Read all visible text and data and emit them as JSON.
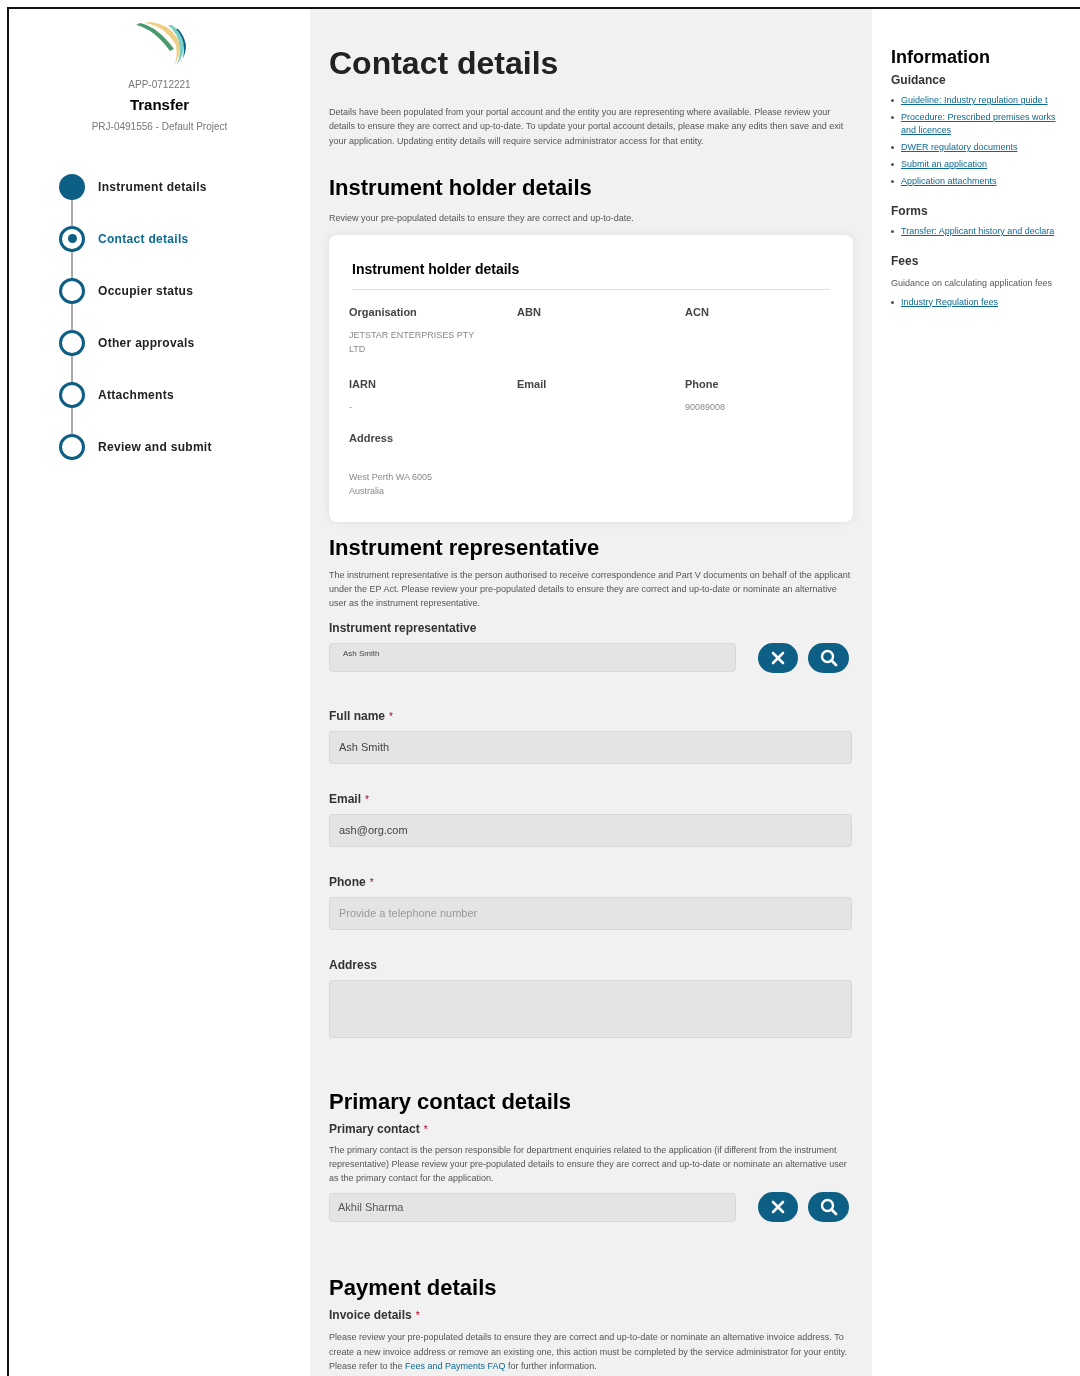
{
  "sidebar": {
    "application_id": "APP-0712221",
    "title": "Transfer",
    "project": "PRJ-0491556 - Default Project",
    "steps": [
      {
        "label": "Instrument details",
        "kind": "complete",
        "selected": false
      },
      {
        "label": "Contact details",
        "kind": "current",
        "selected": true
      },
      {
        "label": "Occupier status",
        "kind": "pending",
        "selected": false
      },
      {
        "label": "Other approvals",
        "kind": "pending",
        "selected": false
      },
      {
        "label": "Attachments",
        "kind": "pending",
        "selected": false
      },
      {
        "label": "Review and submit",
        "kind": "pending",
        "selected": false
      }
    ]
  },
  "main": {
    "title": "Contact details",
    "intro": "Details have been populated from your portal account and the entity you are representing where available. Please review your details to ensure they are correct and up-to-date. To update your portal account details, please make any edits then save and exit your application. Updating entity details will require service administrator access for that entity.",
    "holder": {
      "heading": "Instrument holder details",
      "description": "Review your pre-populated details to ensure they are correct and up-to-date.",
      "card_title": "Instrument holder details",
      "fields": [
        {
          "label": "Organisation",
          "value": "JETSTAR ENTERPRISES PTY LTD"
        },
        {
          "label": "ABN"
        },
        {
          "label": "ACN"
        },
        {
          "label": "IARN",
          "value": "-"
        },
        {
          "label": "Email"
        },
        {
          "label": "Phone",
          "value": "90089008"
        },
        {
          "label": "Address",
          "value": "West Perth WA 6005\nAustralia"
        }
      ]
    },
    "representative": {
      "heading": "Instrument representative",
      "description": "The instrument representative is the person authorised to receive correspondence and Part V documents on behalf of the applicant under the EP Act. Please review your pre-populated details to ensure they are correct and up-to-date or nominate an alternative user as the instrument representative.",
      "lookup_label": "Instrument representative",
      "lookup_value": "Ash Smith",
      "fields": [
        {
          "kind": "input",
          "label": "Full name",
          "required_marker": "*",
          "value": "Ash Smith"
        },
        {
          "kind": "input",
          "label": "Email",
          "required_marker": "*",
          "value": "ash@org.com"
        },
        {
          "kind": "input",
          "label": "Phone",
          "required_marker": "*",
          "placeholder": "Provide a telephone number"
        },
        {
          "kind": "textarea",
          "label": "Address"
        }
      ]
    },
    "primary_contact": {
      "heading": "Primary contact details",
      "label": "Primary contact",
      "required_marker": "*",
      "description": "The primary contact is the person responsible for department enquiries related to the application (if different from the instrument representative) Please review your pre-populated details to ensure they are correct and up-to-date or nominate an alternative user as the primary contact for the application.",
      "value": "Akhil Sharma"
    },
    "payment": {
      "heading": "Payment details",
      "label": "Invoice details",
      "required_marker": "*",
      "description_before": "Please review your pre-populated details to ensure they are correct and up-to-date or nominate an alternative invoice address. To create a new invoice address or remove an existing one, this action must be completed by the service administrator for your entity. Please refer to the ",
      "link": "Fees and Payments FAQ",
      "description_after": " for further information."
    }
  },
  "info": {
    "title": "Information",
    "sections": [
      {
        "heading": "Guidance",
        "links": [
          "Guideline: Industry regulation guide t",
          "Procedure: Prescribed premises works\nand licences",
          "DWER regulatory documents",
          "Submit an application",
          "Application attachments"
        ]
      },
      {
        "heading": "Forms",
        "links": [
          "Transfer: Applicant history and declara"
        ]
      },
      {
        "heading": "Fees",
        "text": "Guidance on calculating application fees",
        "links": [
          "Industry Regulation fees"
        ]
      }
    ]
  }
}
